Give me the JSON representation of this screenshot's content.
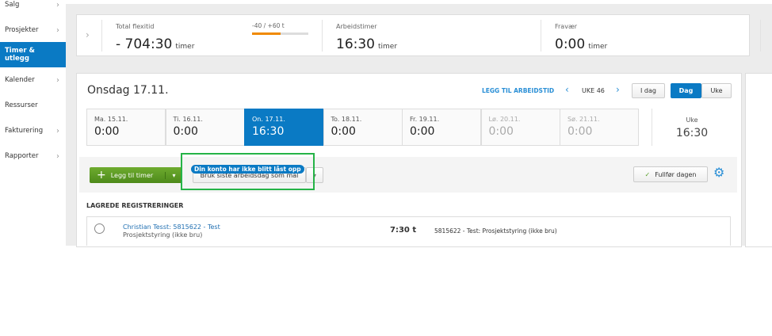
{
  "sidebar": {
    "items": [
      {
        "label": "Salg"
      },
      {
        "label": "Prosjekter"
      },
      {
        "label": "Timer & utlegg"
      },
      {
        "label": "Kalender"
      },
      {
        "label": "Ressurser"
      },
      {
        "label": "Fakturering"
      },
      {
        "label": "Rapporter"
      }
    ]
  },
  "summary": {
    "flex_label": "Total flexitid",
    "flex_value": "- 704:30",
    "unit": "timer",
    "range": "-40 / +60 t",
    "range_progress": 0.5,
    "work_label": "Arbeidstimer",
    "work_value": "16:30",
    "absence_label": "Fravær",
    "absence_value": "0:00"
  },
  "day": {
    "title": "Onsdag 17.11.",
    "add_worktime": "LEGG TIL ARBEIDSTID",
    "week": "UKE 46",
    "today": "I dag",
    "view_day": "Dag",
    "view_week": "Uke"
  },
  "tiles": [
    {
      "d": "Ma. 15.11.",
      "v": "0:00"
    },
    {
      "d": "Ti. 16.11.",
      "v": "0:00"
    },
    {
      "d": "On. 17.11.",
      "v": "16:30"
    },
    {
      "d": "To. 18.11.",
      "v": "0:00"
    },
    {
      "d": "Fr. 19.11.",
      "v": "0:00"
    },
    {
      "d": "Lø. 20.11.",
      "v": "0:00"
    },
    {
      "d": "Sø. 21.11.",
      "v": "0:00"
    }
  ],
  "week_total": {
    "label": "Uke",
    "value": "16:30"
  },
  "actions": {
    "add_hours": "Legg til timer",
    "use_last": "Bruk siste arbeidsdag som mal",
    "tooltip": "Din konto har ikke blitt låst opp",
    "finish_day": "Fullfør dagen"
  },
  "saved": {
    "heading": "LAGREDE REGISTRERINGER",
    "rows": [
      {
        "title": "Christian Tesst: 5815622 - Test",
        "sub": "Prosjektstyring (ikke bru)",
        "hours": "7:30 t",
        "desc": "5815622 - Test: Prosjektstyring (ikke bru)"
      }
    ]
  }
}
